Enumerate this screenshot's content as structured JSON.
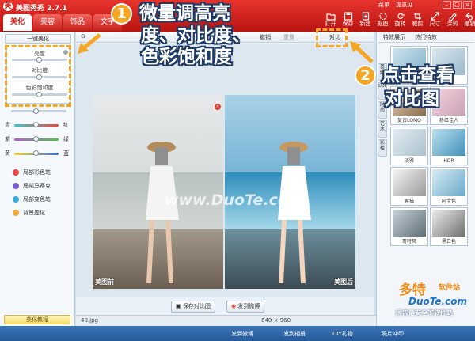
{
  "app": {
    "title": "美图秀秀 2.7.1",
    "top_links": [
      "菜单",
      "提意见"
    ]
  },
  "main_tabs": [
    "美化",
    "美容",
    "饰品",
    "文字"
  ],
  "toolbar_right": [
    {
      "label": "打开",
      "icon": "open-icon"
    },
    {
      "label": "保存",
      "icon": "save-icon"
    },
    {
      "label": "新建",
      "icon": "new-icon"
    },
    {
      "label": "抠图",
      "icon": "cutout-icon"
    },
    {
      "label": "旋转",
      "icon": "rotate-icon"
    },
    {
      "label": "裁剪",
      "icon": "crop-icon"
    },
    {
      "label": "尺寸",
      "icon": "resize-icon"
    },
    {
      "label": "涂鸦",
      "icon": "doodle-icon"
    },
    {
      "label": "撤销",
      "icon": "undo-icon"
    }
  ],
  "left_panel": {
    "one_key_label": "一键美化",
    "adjust": [
      {
        "label": "亮度",
        "value": 0.5
      },
      {
        "label": "对比度",
        "value": 0.5
      },
      {
        "label": "色彩饱和度",
        "value": 0.5
      }
    ],
    "sharpen_value": 0.45,
    "colors": [
      {
        "left": "青",
        "right": "红",
        "value": 0.5
      },
      {
        "left": "紫",
        "right": "绿",
        "value": 0.5
      },
      {
        "left": "黄",
        "right": "蓝",
        "value": 0.5
      }
    ],
    "tools": [
      {
        "label": "局部彩色笔",
        "color": "#e8483e"
      },
      {
        "label": "局部马赛克",
        "color": "#7a5bd0"
      },
      {
        "label": "局部变色笔",
        "color": "#3aa9e0"
      },
      {
        "label": "背景虚化",
        "color": "#f0a93a"
      }
    ],
    "course_label": "美化教程"
  },
  "editor": {
    "toolbar": {
      "zoom": "原大",
      "undo": "撤销",
      "redo": "重做",
      "compare": "对比"
    },
    "before_label": "美图前",
    "after_label": "美图后",
    "watermark": "www.DuoTe.com",
    "save_compare": "保存对比图",
    "send_weibo": "发到微博",
    "filename": "40.jpg",
    "dimensions": "640 × 960"
  },
  "right_panel": {
    "tabs": [
      "特效展示",
      "热门特效"
    ],
    "vertical_tabs": [
      "基础",
      "LOMO",
      "时尚",
      "艺术",
      "影楼"
    ],
    "effects": [
      {
        "label": "",
        "c1": "#cfe3ee",
        "c2": "#7fb0c8"
      },
      {
        "label": "",
        "c1": "#d9e6ef",
        "c2": "#9cb9cc"
      },
      {
        "label": "复古LOMO",
        "c1": "#e8d0b6",
        "c2": "#8a6b4e"
      },
      {
        "label": "粉红佳人",
        "c1": "#f6d3de",
        "c2": "#c8a0b6"
      },
      {
        "label": "淡雅",
        "c1": "#e4edf2",
        "c2": "#a9c1cd"
      },
      {
        "label": "HDR",
        "c1": "#bde0ee",
        "c2": "#3f90b9"
      },
      {
        "label": "素描",
        "c1": "#f5f5f5",
        "c2": "#9a9a9a"
      },
      {
        "label": "阿宝色",
        "c1": "#d7ecf4",
        "c2": "#6aa9c9"
      },
      {
        "label": "哥特风",
        "c1": "#c6d0d6",
        "c2": "#5f6f78"
      },
      {
        "label": "黑白色",
        "c1": "#ececec",
        "c2": "#6f6f6f"
      }
    ]
  },
  "bottom_strip": [
    "发到微博",
    "发到相册",
    "DIY礼物",
    "照片冲印"
  ],
  "callouts": {
    "step1_num": "1",
    "step1_line1": "微量调高亮",
    "step1_line2": "度、对比度、",
    "step1_line3": "色彩饱和度",
    "step2_num": "2",
    "step2_line1": "点击查看",
    "step2_line2": "对比图"
  },
  "brand": {
    "line1": "多特",
    "line2": "软件站",
    "line3": "DuoTe.com",
    "line4": "国内最安全的软件站"
  },
  "colors": {
    "titlebar": "#d01c17",
    "callout_orange": "#f5a623",
    "callout_outline": "#1e3a64"
  }
}
